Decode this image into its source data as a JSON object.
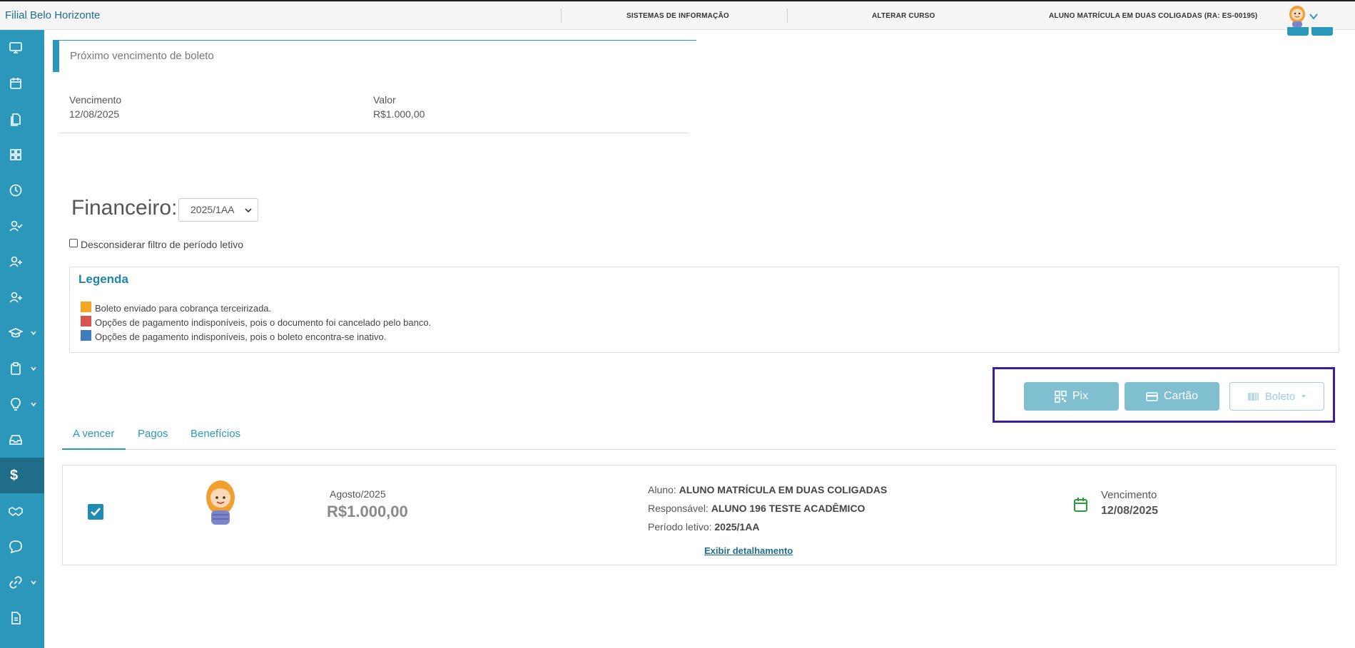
{
  "header": {
    "brand": "Filial Belo Horizonte",
    "nav": {
      "sistemas": "SISTEMAS DE INFORMAÇÃO",
      "alterar": "ALTERAR CURSO",
      "aluno": "ALUNO MATRÍCULA EM DUAS COLIGADAS (RA: ES-00195)"
    }
  },
  "sidebar": {
    "items": [
      "monitor-icon",
      "calendar-icon",
      "documents-icon",
      "grid-icon",
      "clock-icon",
      "user-check-icon",
      "user-plus-icon",
      "user-plus-icon",
      "graduation-cap-icon",
      "clipboard-icon",
      "lightbulb-icon",
      "inbox-icon",
      "dollar-icon",
      "handshake-icon",
      "chat-icon",
      "link-icon",
      "file-icon"
    ],
    "active": "dollar-icon",
    "dollar_glyph": "$"
  },
  "next_due": {
    "title": "Próximo vencimento de boleto",
    "vencimento_label": "Vencimento",
    "vencimento_value": "12/08/2025",
    "valor_label": "Valor",
    "valor_value": "R$1.000,00"
  },
  "financeiro": {
    "title": "Financeiro:",
    "period_selected": "2025/1AA",
    "filter_label": "Desconsiderar filtro de período letivo"
  },
  "legenda": {
    "title": "Legenda",
    "items": [
      {
        "color": "#f5a623",
        "text": "Boleto enviado para cobrança terceirizada."
      },
      {
        "color": "#d9534f",
        "text": "Opções de pagamento indisponíveis, pois o documento foi cancelado pelo banco."
      },
      {
        "color": "#3f7cc0",
        "text": "Opções de pagamento indisponíveis, pois o boleto encontra-se inativo."
      }
    ]
  },
  "payment": {
    "pix": "Pix",
    "cartao": "Cartão",
    "boleto": "Boleto"
  },
  "tabs": {
    "a_vencer": "A vencer",
    "pagos": "Pagos",
    "beneficios": "Benefícios"
  },
  "item": {
    "month": "Agosto/2025",
    "amount": "R$1.000,00",
    "aluno_label": "Aluno:",
    "aluno_value": "ALUNO MATRÍCULA EM DUAS COLIGADAS",
    "responsavel_label": "Responsável:",
    "responsavel_value": "ALUNO 196 TESTE ACADÊMICO",
    "periodo_label": "Período letivo:",
    "periodo_value": "2025/1AA",
    "detail_link": "Exibir detalhamento",
    "venc_label": "Vencimento",
    "venc_value": "12/08/2025",
    "checked": true
  },
  "colors": {
    "accent": "#2b97bb",
    "sidebar_active": "#1f6d89",
    "pay_buttons": "#7fbfd0",
    "highlight_box": "#3d1aa6",
    "calendar_green": "#2a9d3a"
  }
}
